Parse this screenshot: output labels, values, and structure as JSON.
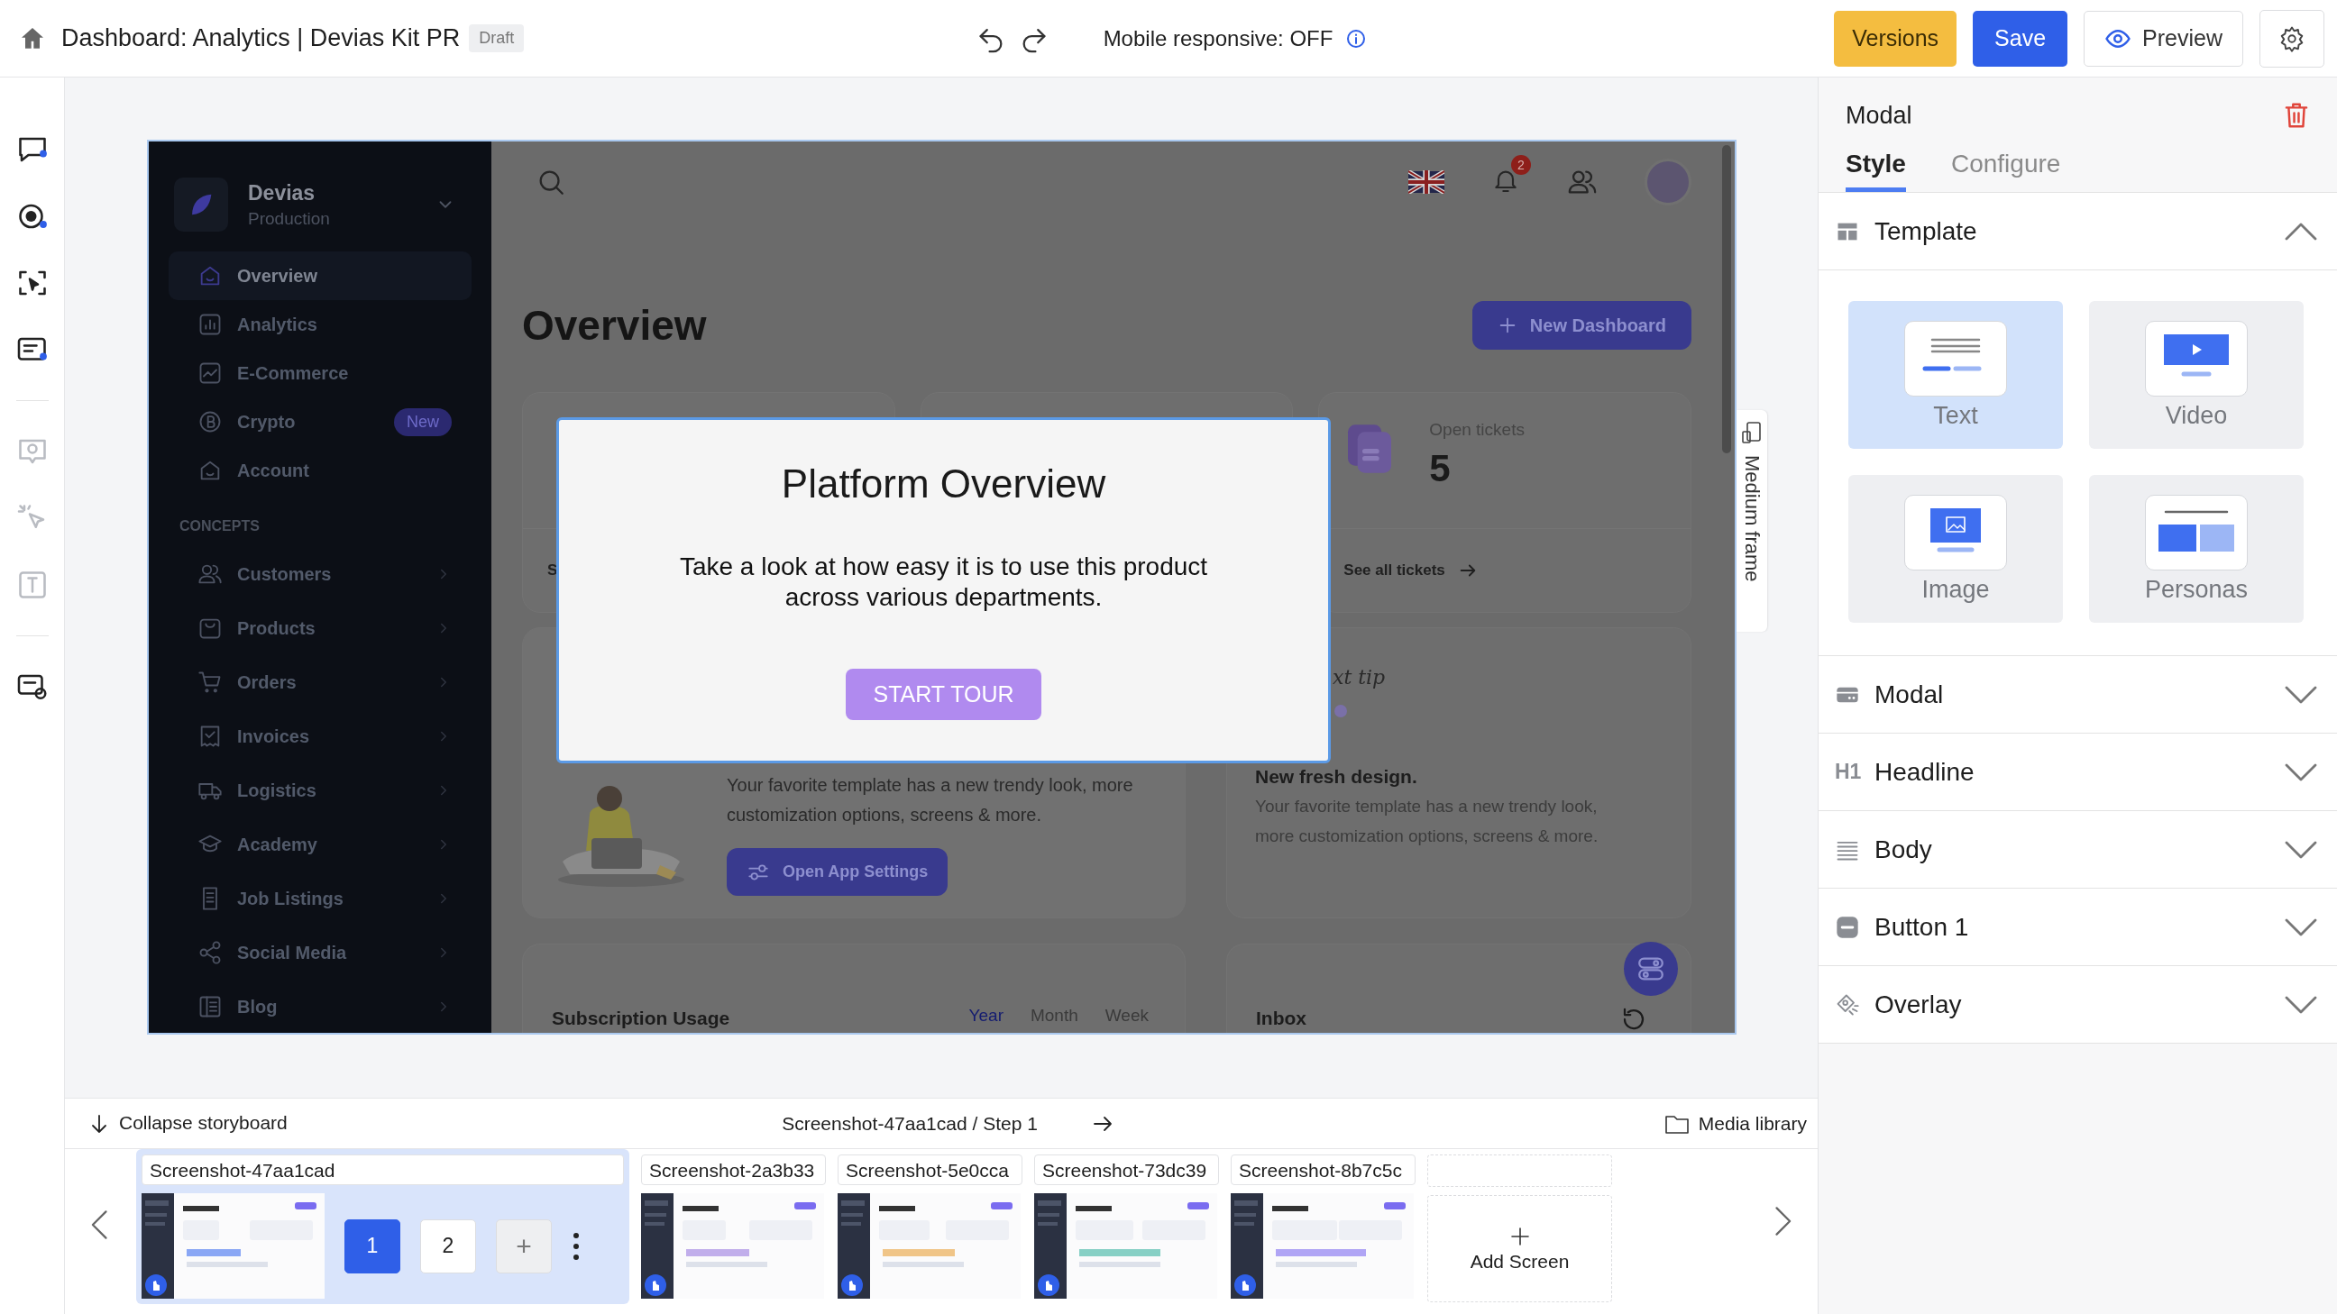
{
  "topbar": {
    "title": "Dashboard: Analytics | Devias Kit PR",
    "badge": "Draft",
    "responsive_label": "Mobile responsive: OFF",
    "buttons": [
      {
        "label": "Versions",
        "kind": "versions"
      },
      {
        "label": "Save",
        "kind": "primary"
      },
      {
        "label": "Preview",
        "kind": "outline"
      }
    ]
  },
  "canvas": {
    "frame_label": "Medium frame",
    "app": {
      "brand": "Devias",
      "environment": "Production",
      "nav": [
        {
          "label": "Overview",
          "selected": true
        },
        {
          "label": "Analytics",
          "selected": false
        },
        {
          "label": "E-Commerce",
          "selected": false
        },
        {
          "label": "Crypto",
          "selected": false,
          "badge": "New"
        },
        {
          "label": "Account",
          "selected": false
        }
      ],
      "section_label": "CONCEPTS",
      "concepts": [
        {
          "label": "Customers",
          "expanded": false
        },
        {
          "label": "Products",
          "expanded": false
        },
        {
          "label": "Orders",
          "expanded": false
        },
        {
          "label": "Invoices",
          "expanded": false
        },
        {
          "label": "Logistics",
          "expanded": false
        },
        {
          "label": "Academy",
          "expanded": false
        },
        {
          "label": "Job Listings",
          "expanded": false
        },
        {
          "label": "Social Media",
          "expanded": false
        },
        {
          "label": "Blog",
          "expanded": false
        }
      ],
      "notification_count": "2",
      "heading": "Overview",
      "new_button": "New Dashboard",
      "stat_cards": [
        {
          "link": "S"
        },
        {
          "label": "Open tickets",
          "value": "5",
          "link": "See all tickets"
        }
      ],
      "promo": {
        "text": "Your favorite template has a new trendy look, more customization options, screens & more.",
        "button": "Open App Settings"
      },
      "tip": {
        "label": "xt tip",
        "title": "New fresh design.",
        "text": "Your favorite template has a new trendy look, more customization options, screens & more."
      },
      "subscription": {
        "title": "Subscription Usage",
        "periods": [
          {
            "label": "Year",
            "selected": true
          },
          {
            "label": "Month",
            "selected": false
          },
          {
            "label": "Week",
            "selected": false
          }
        ]
      },
      "inbox": {
        "title": "Inbox"
      },
      "modal": {
        "title": "Platform Overview",
        "body": "Take a look at how easy it is to use this product across various departments.",
        "button": "START TOUR"
      }
    }
  },
  "panel": {
    "title": "Modal",
    "tabs": [
      {
        "label": "Style",
        "selected": true
      },
      {
        "label": "Configure",
        "selected": false
      }
    ],
    "sections": [
      {
        "title": "Template",
        "expanded": true,
        "templates": [
          {
            "label": "Text",
            "selected": true
          },
          {
            "label": "Video",
            "selected": false
          },
          {
            "label": "Image",
            "selected": false
          },
          {
            "label": "Personas",
            "selected": false
          }
        ]
      },
      {
        "title": "Modal",
        "expanded": false
      },
      {
        "title": "Headline",
        "expanded": false,
        "icon_label": "H1"
      },
      {
        "title": "Body",
        "expanded": false
      },
      {
        "title": "Button 1",
        "expanded": false
      },
      {
        "title": "Overlay",
        "expanded": false
      }
    ]
  },
  "storyboard": {
    "collapse_label": "Collapse storyboard",
    "breadcrumb": "Screenshot-47aa1cad / Step 1",
    "media_label": "Media library",
    "screens": [
      {
        "name": "Screenshot-47aa1cad",
        "selected": true,
        "steps": [
          {
            "label": "1",
            "selected": true
          },
          {
            "label": "2",
            "selected": false
          }
        ],
        "add_step": "+"
      },
      {
        "name": "Screenshot-2a3b33",
        "selected": false
      },
      {
        "name": "Screenshot-5e0cca",
        "selected": false
      },
      {
        "name": "Screenshot-73dc39",
        "selected": false
      },
      {
        "name": "Screenshot-8b7c5c",
        "selected": false
      }
    ],
    "add_label": "Add Screen"
  }
}
